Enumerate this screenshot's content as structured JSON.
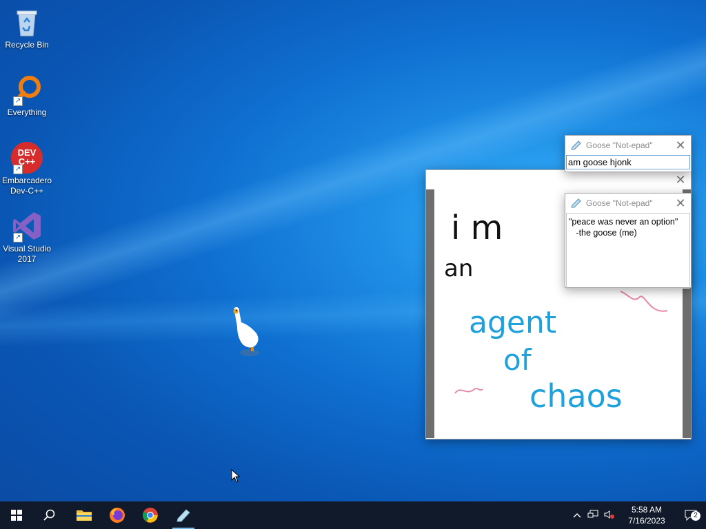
{
  "desktop": {
    "icons": [
      {
        "label": "Recycle Bin",
        "icon": "recycle-bin-icon"
      },
      {
        "label": "Everything",
        "icon": "everything-search-icon"
      },
      {
        "label": "Embarcadero Dev-C++",
        "badge": "DEV C++",
        "icon": "dev-cpp-icon"
      },
      {
        "label": "Visual Studio 2017",
        "icon": "visual-studio-icon"
      }
    ]
  },
  "goose_notepad_1": {
    "title": "Goose \"Not-epad\"",
    "text": "am goose hjonk"
  },
  "goose_notepad_2": {
    "title": "Goose \"Not-epad\"",
    "text": "\"peace was never an option\"\n   -the goose (me)"
  },
  "drawing": {
    "lines": [
      "i  m",
      "an",
      "agent",
      "of",
      "chaos"
    ],
    "colors": {
      "black": "#111111",
      "blue": "#1fa2dc",
      "pink": "#e88aa8"
    }
  },
  "taskbar": {
    "apps": [
      {
        "name": "File Explorer",
        "icon": "folder-icon"
      },
      {
        "name": "Firefox",
        "icon": "firefox-icon"
      },
      {
        "name": "Google Chrome",
        "icon": "chrome-icon"
      },
      {
        "name": "Desktop Goose",
        "icon": "notepad-icon",
        "active": true
      }
    ],
    "time": "5:58 AM",
    "date": "7/16/2023",
    "notification_count": "2"
  }
}
